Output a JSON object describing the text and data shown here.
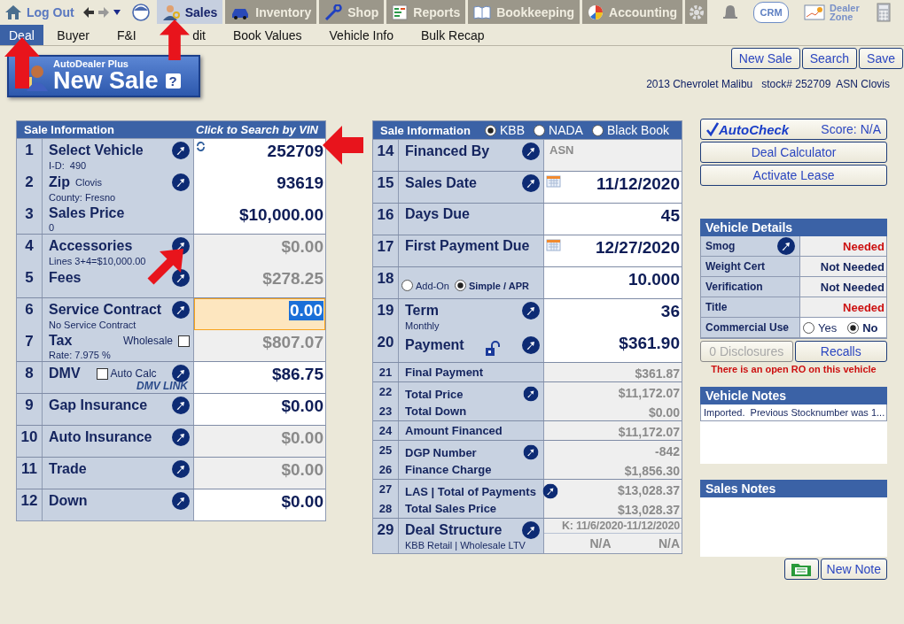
{
  "topbar": {
    "logout": "Log Out",
    "modules": [
      {
        "label": "Sales",
        "selected": true
      },
      {
        "label": "Inventory",
        "selected": false
      },
      {
        "label": "Shop",
        "selected": false
      },
      {
        "label": "Reports",
        "selected": false
      },
      {
        "label": "Bookkeeping",
        "selected": false
      },
      {
        "label": "Accounting",
        "selected": false
      }
    ],
    "crm": "CRM",
    "dealer_zone": [
      "Dealer",
      "Zone"
    ]
  },
  "sub_tabs": [
    {
      "label": "Deal",
      "selected": true
    },
    {
      "label": "Buyer",
      "selected": false
    },
    {
      "label": "F&I",
      "selected": false
    },
    {
      "label": "dit",
      "selected": false
    },
    {
      "label": "Book Values",
      "selected": false
    },
    {
      "label": "Vehicle Info",
      "selected": false
    },
    {
      "label": "Bulk Recap",
      "selected": false
    }
  ],
  "logo": {
    "subtitle": "AutoDealer Plus",
    "title": "New Sale",
    "help": "?"
  },
  "actions": [
    "New Sale",
    "Search",
    "Save"
  ],
  "vehicle_line": "2013 Chevrolet Malibu   stock# 252709  ASN Clovis",
  "left_panel": {
    "title": "Sale Information",
    "link": "Click to Search by VIN",
    "rows": [
      {
        "number": "1",
        "label": "Select Vehicle",
        "sub": "I-D:  490",
        "value": "252709",
        "action": true,
        "refresh": true,
        "readonly": false,
        "focused": false
      },
      {
        "number": "2",
        "label": "Zip",
        "aside": "Clovis",
        "sub": "County: Fresno",
        "value": "93619",
        "action": true,
        "readonly": false,
        "focused": false
      },
      {
        "number": "3",
        "label": "Sales Price",
        "sub": "0",
        "value": "$10,000.00",
        "action": false,
        "readonly": false,
        "focused": false
      },
      {
        "number": "4",
        "label": "Accessories",
        "sub": "Lines 3+4=$10,000.00",
        "value": "$0.00",
        "action": true,
        "readonly": true,
        "focused": false
      },
      {
        "number": "5",
        "label": "Fees",
        "value": "$278.25",
        "action": true,
        "readonly": true,
        "focused": false
      },
      {
        "number": "6",
        "label": "Service Contract",
        "sub": "No Service Contract",
        "value": "0.00",
        "action": true,
        "readonly": false,
        "focused": true
      },
      {
        "number": "7",
        "label": "Tax",
        "aside": "Wholesale",
        "checkbox": {
          "checked": false
        },
        "sub": "Rate: 7.975 %",
        "value": "$807.07",
        "action": false,
        "readonly": true,
        "focused": false
      },
      {
        "number": "8",
        "label": "DMV",
        "checkbox": {
          "label": "Auto Calc",
          "checked": false
        },
        "logo": "DMV LINK",
        "value": "$86.75",
        "action": true,
        "readonly": false,
        "focused": false
      },
      {
        "number": "9",
        "label": "Gap Insurance",
        "value": "$0.00",
        "action": true,
        "readonly": false,
        "focused": false
      },
      {
        "number": "10",
        "label": "Auto Insurance",
        "value": "$0.00",
        "action": true,
        "readonly": true,
        "focused": false
      },
      {
        "number": "11",
        "label": "Trade",
        "value": "$0.00",
        "action": true,
        "readonly": true,
        "focused": false
      },
      {
        "number": "12",
        "label": "Down",
        "value": "$0.00",
        "action": true,
        "readonly": false,
        "focused": false
      }
    ]
  },
  "middle_panel": {
    "title": "Sale Information",
    "sources": [
      {
        "label": "KBB",
        "selected": true
      },
      {
        "label": "NADA",
        "selected": false
      },
      {
        "label": "Black Book",
        "selected": false
      }
    ],
    "rows": [
      {
        "kind": "note",
        "number": "14",
        "label": "Financed By",
        "value": "ASN",
        "action": true,
        "readonly": true,
        "compact": false
      },
      {
        "kind": "amount",
        "number": "15",
        "label": "Sales Date",
        "value": "11/12/2020",
        "action": true,
        "calendar": true,
        "readonly": false,
        "compact": false
      },
      {
        "kind": "amount",
        "number": "16",
        "label": "Days Due",
        "value": "45",
        "action": false,
        "readonly": false,
        "compact": false
      },
      {
        "kind": "amount",
        "number": "17",
        "label": "First Payment Due",
        "value": "12/27/2020",
        "action": false,
        "calendar": true,
        "readonly": false,
        "compact": false
      },
      {
        "kind": "radio",
        "number": "18",
        "options": [
          {
            "label": "Add-On",
            "selected": false
          },
          {
            "label": "Simple / APR",
            "selected": true
          }
        ],
        "value": "10.000",
        "readonly": false,
        "compact": false
      },
      {
        "kind": "amount",
        "number": "19",
        "label": "Term",
        "sub": "Monthly",
        "value": "36",
        "action": true,
        "readonly": false,
        "compact": false
      },
      {
        "kind": "amount",
        "number": "20",
        "label": "Payment",
        "locked": false,
        "value": "$361.90",
        "action": true,
        "readonly": false,
        "compact": false
      },
      {
        "kind": "amount",
        "number": "21",
        "label": "Final Payment",
        "value": "$361.87",
        "action": false,
        "readonly": true,
        "compact": true
      },
      {
        "kind": "amount",
        "number": "22",
        "label": "Total Price",
        "value": "$11,172.07",
        "action": true,
        "readonly": true,
        "compact": true
      },
      {
        "kind": "amount",
        "number": "23",
        "label": "Total Down",
        "value": "$0.00",
        "action": false,
        "readonly": true,
        "compact": true
      },
      {
        "kind": "amount",
        "number": "24",
        "label": "Amount Financed",
        "value": "$11,172.07",
        "action": false,
        "readonly": true,
        "compact": true
      },
      {
        "kind": "amount",
        "number": "25",
        "label": "DGP Number",
        "value": "-842",
        "action": true,
        "readonly": true,
        "compact": true
      },
      {
        "kind": "amount",
        "number": "26",
        "label": "Finance Charge",
        "value": "$1,856.30",
        "action": false,
        "readonly": true,
        "compact": true
      },
      {
        "kind": "amount",
        "number": "27",
        "label": "LAS | Total of Payments",
        "value": "$13,028.37",
        "action": true,
        "readonly": true,
        "compact": true
      },
      {
        "kind": "amount",
        "number": "28",
        "label": "Total Sales Price",
        "value": "$13,028.37",
        "action": false,
        "readonly": true,
        "compact": true
      },
      {
        "kind": "structure",
        "number": "29",
        "label": "Deal Structure",
        "sub": "KBB Retail | Wholesale LTV",
        "range": "K: 11/6/2020-11/12/2020",
        "values": [
          "N/A",
          "N/A"
        ],
        "action": true,
        "readonly": true,
        "compact": false
      }
    ]
  },
  "right_panel": {
    "autocheck": {
      "label": "AutoCheck",
      "score": "Score:  N/A"
    },
    "buttons": [
      "Deal Calculator",
      "Activate Lease"
    ],
    "vehicle_details": {
      "title": "Vehicle Details",
      "rows": [
        {
          "kind": "status",
          "label": "Smog",
          "value": "Needed",
          "needed": true,
          "action": true
        },
        {
          "kind": "status",
          "label": "Weight Cert",
          "value": "Not Needed",
          "needed": false,
          "action": false
        },
        {
          "kind": "status",
          "label": "Verification",
          "value": "Not Needed",
          "needed": false,
          "action": false
        },
        {
          "kind": "status",
          "label": "Title",
          "value": "Needed",
          "needed": true,
          "action": false
        },
        {
          "kind": "radio",
          "label": "Commercial Use",
          "options": [
            {
              "label": "Yes",
              "selected": false
            },
            {
              "label": "No",
              "selected": true
            }
          ]
        }
      ]
    },
    "detail_buttons": [
      {
        "label": "0 Disclosures",
        "disabled": true
      },
      {
        "label": "Recalls",
        "disabled": false
      }
    ],
    "warning": "There is an open RO on this vehicle",
    "vehicle_notes": {
      "title": "Vehicle Notes",
      "notes": [
        "Imported.  Previous Stocknumber was 1..."
      ]
    },
    "sales_notes": {
      "title": "Sales Notes"
    },
    "note_button": "New Note"
  }
}
